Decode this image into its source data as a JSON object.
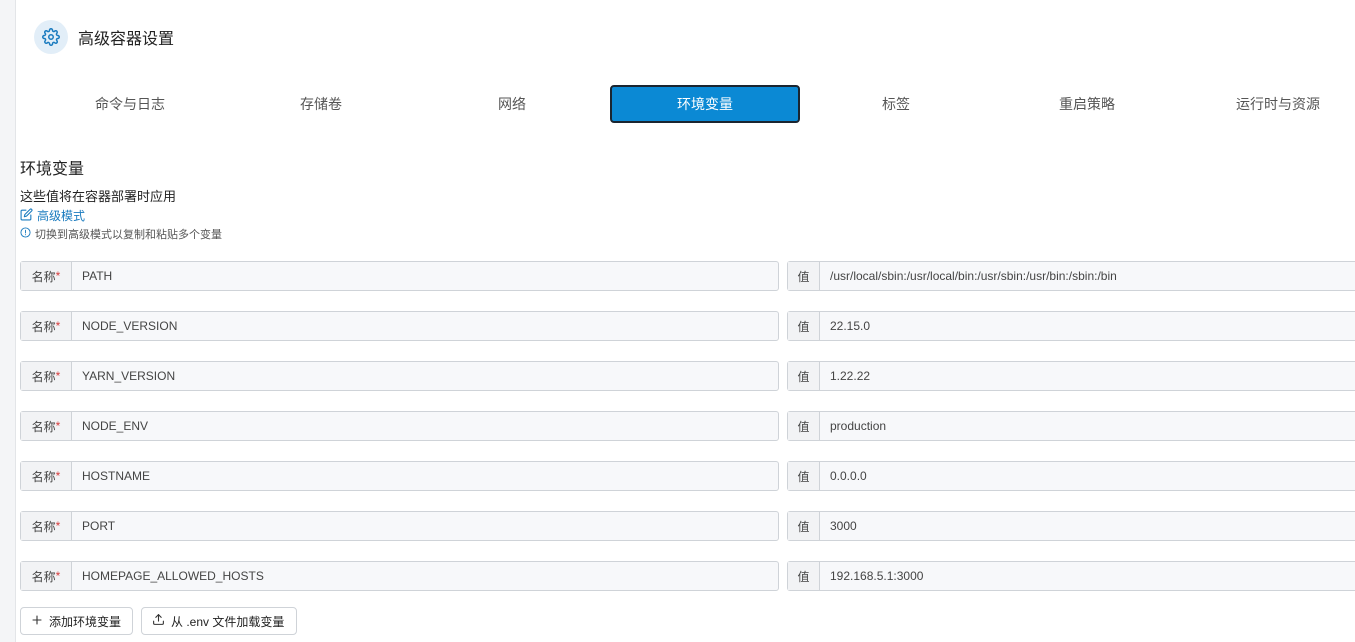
{
  "header": {
    "title": "高级容器设置",
    "icon": "gear-icon",
    "accent": "#0b89d4"
  },
  "tabs": [
    {
      "label": "命令与日志"
    },
    {
      "label": "存储卷"
    },
    {
      "label": "网络"
    },
    {
      "label": "环境变量",
      "active": true
    },
    {
      "label": "标签"
    },
    {
      "label": "重启策略"
    },
    {
      "label": "运行时与资源"
    }
  ],
  "section": {
    "title": "环境变量",
    "desc": "这些值将在容器部署时应用",
    "advanced_link": "高级模式",
    "hint": "切换到高级模式以复制和粘贴多个变量"
  },
  "labels": {
    "name": "名称",
    "required": "*",
    "value": "值"
  },
  "env": [
    {
      "name": "PATH",
      "value": "/usr/local/sbin:/usr/local/bin:/usr/sbin:/usr/bin:/sbin:/bin"
    },
    {
      "name": "NODE_VERSION",
      "value": "22.15.0"
    },
    {
      "name": "YARN_VERSION",
      "value": "1.22.22"
    },
    {
      "name": "NODE_ENV",
      "value": "production"
    },
    {
      "name": "HOSTNAME",
      "value": "0.0.0.0"
    },
    {
      "name": "PORT",
      "value": "3000"
    },
    {
      "name": "HOMEPAGE_ALLOWED_HOSTS",
      "value": "192.168.5.1:3000"
    }
  ],
  "buttons": {
    "add": "添加环境变量",
    "load": "从 .env 文件加载变量"
  }
}
